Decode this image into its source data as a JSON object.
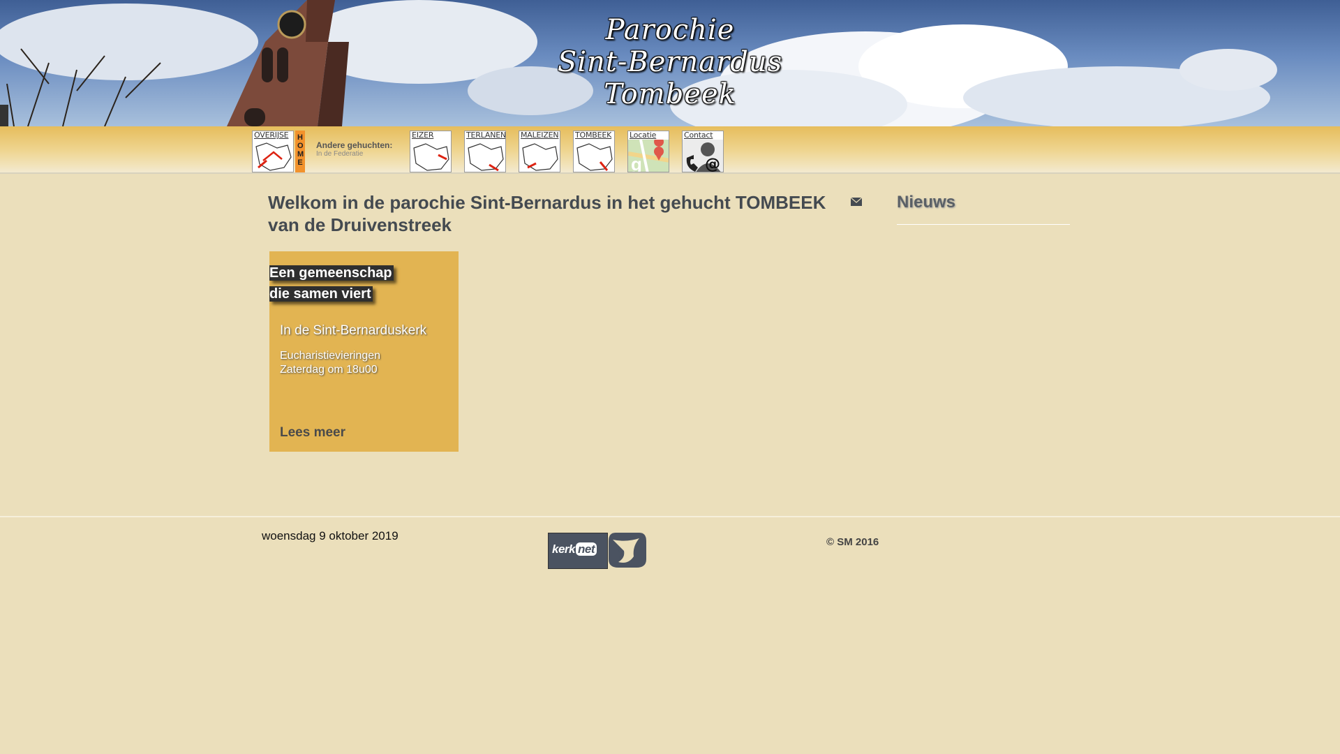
{
  "banner": {
    "title_line1": "Parochie",
    "title_line2": "Sint-Bernardus",
    "title_line3": "Tombeek"
  },
  "nav": {
    "home_tile_label": "OVERIJSE",
    "home_strip": "HOME",
    "other_label": "Andere gehuchten:",
    "other_sub": "In de Federatie",
    "tiles": [
      {
        "label": "EIZER",
        "icon": "map-icon"
      },
      {
        "label": "TERLANEN",
        "icon": "map-icon"
      },
      {
        "label": "MALEIZEN",
        "icon": "map-icon"
      },
      {
        "label": "TOMBEEK",
        "icon": "map-icon"
      },
      {
        "label": "Locatie",
        "icon": "location-map-icon"
      },
      {
        "label": "Contact",
        "icon": "contact-phone-icon"
      }
    ]
  },
  "main": {
    "heading": "Welkom in de parochie Sint-Bernardus in het gehucht TOMBEEK van de Druivenstreek",
    "card": {
      "title": "Een gemeenschap die samen viert",
      "subtitle": "In de Sint-Bernarduskerk",
      "text_line1": "Eucharistievieringen",
      "text_line2": "Zaterdag om 18u00",
      "more_link": "Lees meer"
    },
    "news_title": "Nieuws"
  },
  "footer": {
    "date": "woensdag 9 oktober 2019",
    "copyright": "© SM 2016",
    "kerknet_text": "kerk",
    "kerknet_net": "net"
  },
  "colors": {
    "background": "#ebdfbb",
    "card": "#e2b452",
    "home_strip": "#f2922c"
  }
}
